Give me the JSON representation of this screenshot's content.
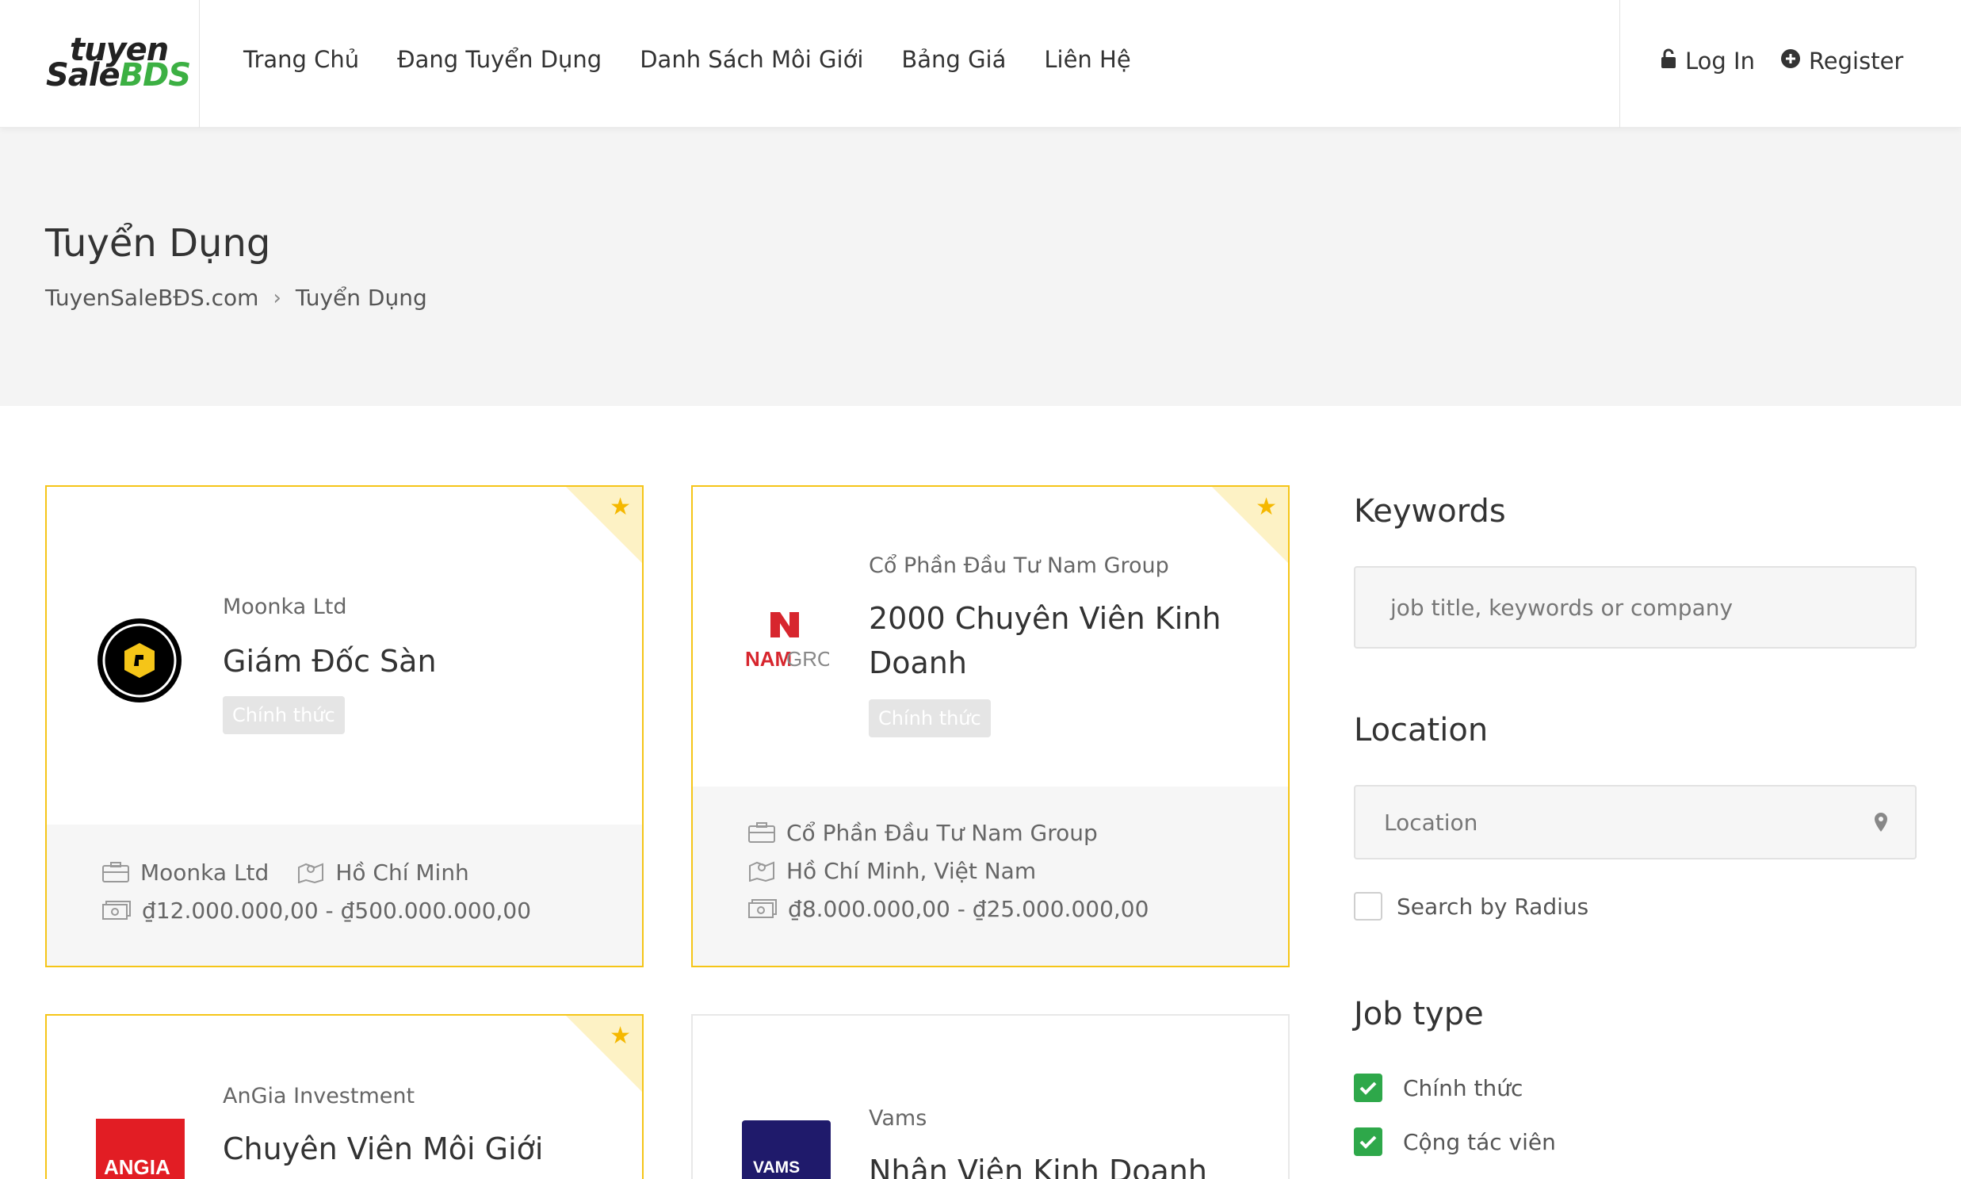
{
  "header": {
    "logo_top": "tuyen",
    "logo_bottom_a": "Sale",
    "logo_bottom_b": "BDS",
    "nav": [
      "Trang Chủ",
      "Đang Tuyển Dụng",
      "Danh Sách Môi Giới",
      "Bảng Giá",
      "Liên Hệ"
    ],
    "login": "Log In",
    "register": "Register"
  },
  "banner": {
    "title": "Tuyển Dụng",
    "breadcrumb": [
      "TuyenSaleBĐS.com",
      "Tuyển Dụng"
    ]
  },
  "jobs": [
    {
      "company": "Moonka Ltd",
      "title": "Giám Đốc Sàn",
      "badge": "Chính thức",
      "featured": true,
      "foot_company": "Moonka Ltd",
      "foot_location": "Hồ Chí Minh",
      "salary": "₫12.000.000,00 - ₫500.000.000,00"
    },
    {
      "company": "Cổ Phần Đầu Tư Nam Group",
      "title": "2000 Chuyên Viên Kinh Doanh",
      "badge": "Chính thức",
      "featured": true,
      "logo_text_a": "NAM",
      "logo_text_b": "GROUP",
      "foot_company": "Cổ Phần Đầu Tư Nam Group",
      "foot_location": "Hồ Chí Minh, Việt Nam",
      "salary": "₫8.000.000,00 - ₫25.000.000,00"
    },
    {
      "company": "AnGia Investment",
      "title": "Chuyên Viên Môi Giới",
      "featured": true,
      "logo_text": "ANGIA"
    },
    {
      "company": "Vams",
      "title": "Nhân Viên Kinh Doanh",
      "featured": false,
      "logo_text": "VAMS"
    }
  ],
  "sidebar": {
    "keywords_heading": "Keywords",
    "keywords_placeholder": "job title, keywords or company",
    "location_heading": "Location",
    "location_placeholder": "Location",
    "radius_label": "Search by Radius",
    "radius_checked": false,
    "jobtype_heading": "Job type",
    "jobtypes": [
      {
        "label": "Chính thức",
        "checked": true
      },
      {
        "label": "Cộng tác viên",
        "checked": true
      }
    ]
  },
  "colors": {
    "accent_yellow": "#f5c518",
    "check_green": "#2ea84a",
    "logo_green": "#3cb043",
    "nam_red": "#d7262e",
    "angia_red": "#e21d24",
    "vams_navy": "#1f1a6b"
  }
}
